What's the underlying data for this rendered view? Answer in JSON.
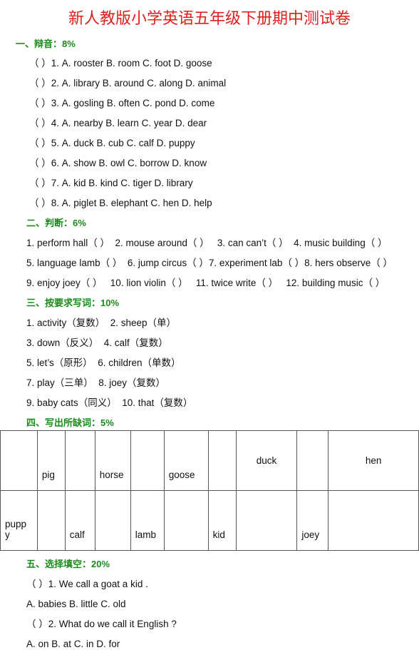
{
  "title": "新人教版小学英语五年级下册期中测试卷",
  "s1": {
    "heading": "一、辩音：8%",
    "items": [
      "（ ）1. A. rooster B. room C. foot D. goose",
      "（ ）2. A. library B. around C. along D. animal",
      "（ ）3. A. gosling B. often C. pond D. come",
      "（ ）4. A. nearby B. learn C. year D. dear",
      "（ ）5. A. duck B. cub C. calf D. puppy",
      "（ ）6. A. show B. owl C. borrow D. know",
      "（ ）7. A. kid B. kind C. tiger D. library",
      "（ ）8. A. piglet B. elephant C. hen D. help"
    ]
  },
  "s2": {
    "heading": "二、判断：6%",
    "lines": [
      "1. perform hall（ ）  2. mouse around（ ）   3. can can’t（ ）  4. music building（ ）",
      "5. language lamb（ ）  6. jump circus（ ）7. experiment lab（ ）8. hers observe（ ）",
      "9. enjoy joey（ ）   10. lion violin（ ）   11. twice write（ ）   12. building music（ ）"
    ]
  },
  "s3": {
    "heading": "三、按要求写词：10%",
    "lines": [
      "1. activity（复数）  2. sheep（单）",
      "3. down（反义）  4. calf（复数）",
      "5. let’s（原形）  6. children（单数）",
      "7. play（三单）  8. joey（复数）",
      "9. baby cats（同义）  10. that（复数）"
    ]
  },
  "s4": {
    "heading": "四、写出所缺词：5%",
    "row1": [
      "",
      "pig",
      "",
      "horse",
      "",
      "goose",
      "",
      "duck",
      "",
      "hen"
    ],
    "row2": [
      "pupp y",
      "",
      "calf",
      "",
      "lamb",
      "",
      "kid",
      "",
      "joey",
      ""
    ]
  },
  "s5": {
    "heading": "五、选择填空：20%",
    "lines": [
      "（ ）1. We call a goat a kid .",
      "A. babies B. little C. old",
      "（ ）2. What do we call it English ?",
      "A. on B. at C. in D. for"
    ]
  }
}
